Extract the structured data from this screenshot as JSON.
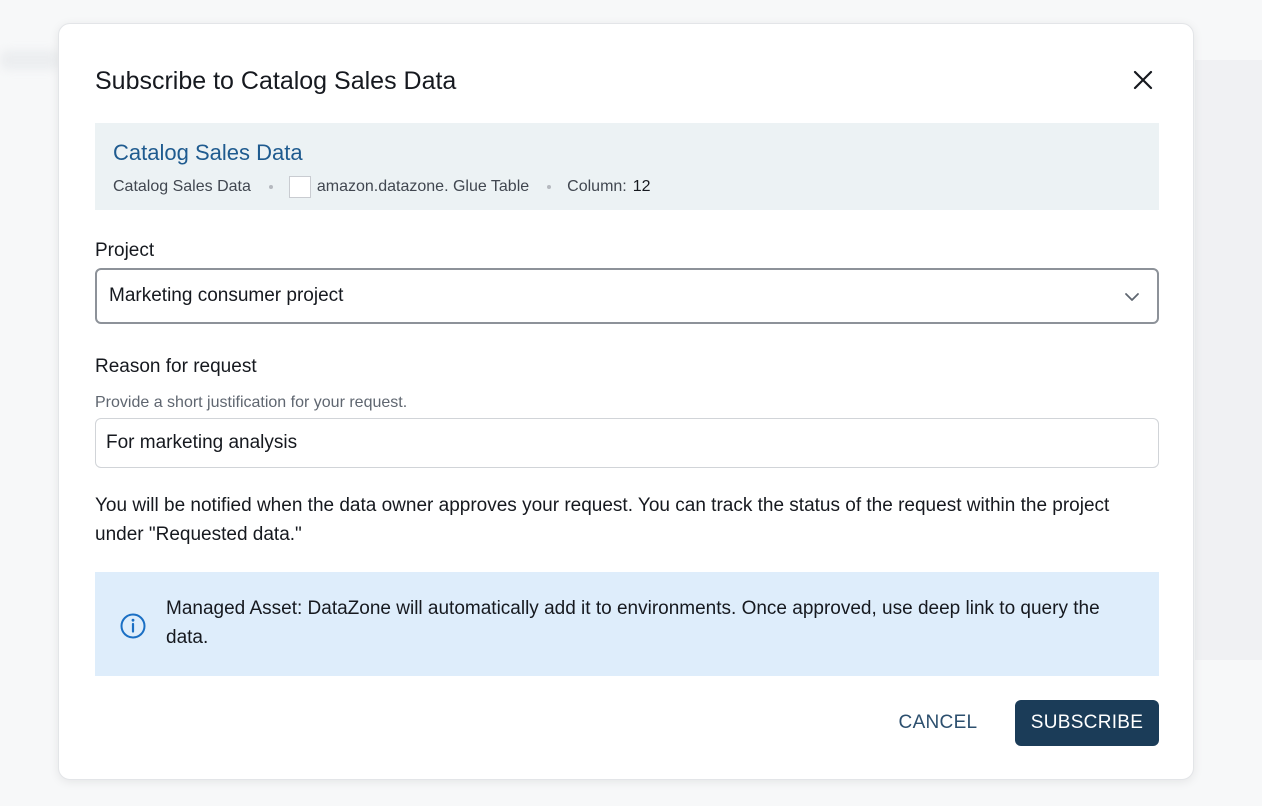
{
  "dialog": {
    "title": "Subscribe to Catalog Sales Data",
    "close_icon": "close-icon"
  },
  "asset": {
    "name": "Catalog Sales Data",
    "meta_source": "Catalog Sales Data",
    "meta_type": "amazon.datazone. Glue Table",
    "meta_column_label": "Column:",
    "meta_column_value": "12"
  },
  "project": {
    "label": "Project",
    "selected": "Marketing consumer project",
    "dropdown_icon": "chevron-down-icon"
  },
  "reason": {
    "label": "Reason for request",
    "hint": "Provide a short justification for your request.",
    "value": "For marketing analysis"
  },
  "notice": "You will be notified when the data owner approves your request. You can track the status of the request within the project under \"Requested data.\"",
  "info": {
    "icon": "info-icon",
    "text": "Managed Asset: DataZone will automatically add it to environments. Once approved, use deep link to query the data.",
    "background": "#deedfb"
  },
  "actions": {
    "cancel_label": "CANCEL",
    "subscribe_label": "SUBSCRIBE",
    "primary_color": "#1b3c58"
  }
}
